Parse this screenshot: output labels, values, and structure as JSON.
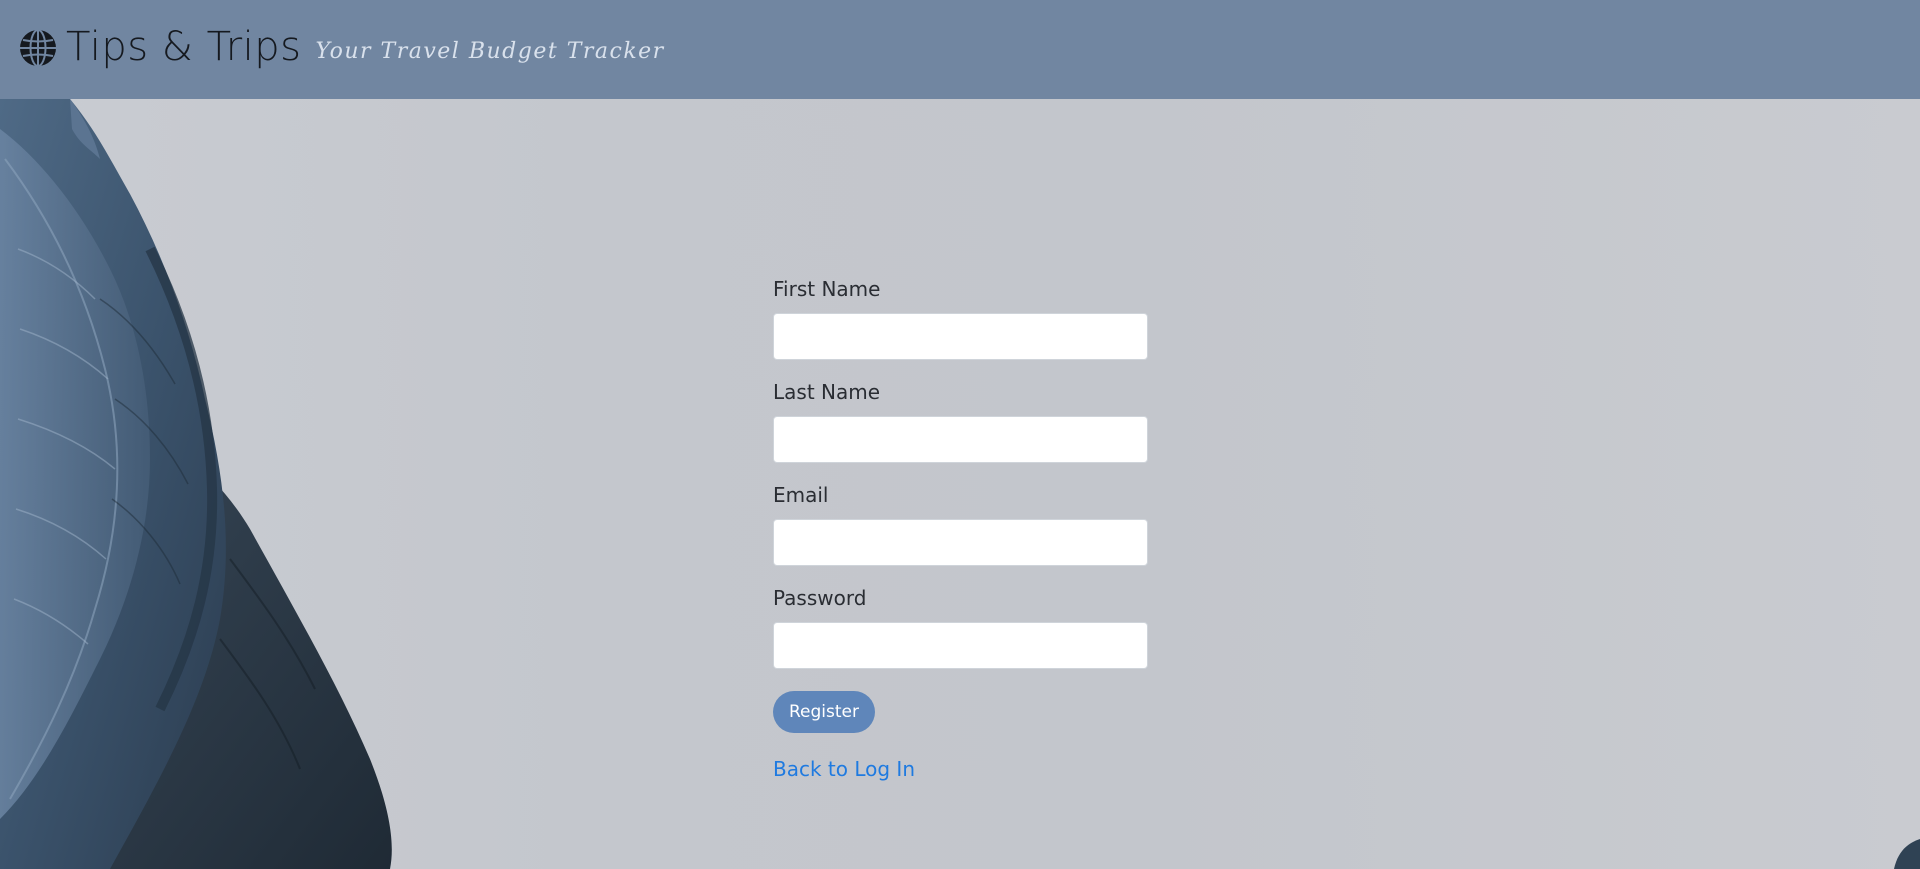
{
  "header": {
    "icon": "globe-icon",
    "title": "Tips & Trips",
    "tagline": "Your Travel Budget Tracker"
  },
  "form": {
    "first_name_label": "First Name",
    "first_name_value": "",
    "last_name_label": "Last Name",
    "last_name_value": "",
    "email_label": "Email",
    "email_value": "",
    "password_label": "Password",
    "password_value": "",
    "register_label": "Register",
    "back_link_label": "Back to Log In"
  },
  "colors": {
    "header_bg": "#7186a1",
    "button_bg": "#5f86ba",
    "link": "#1f7ae0"
  }
}
